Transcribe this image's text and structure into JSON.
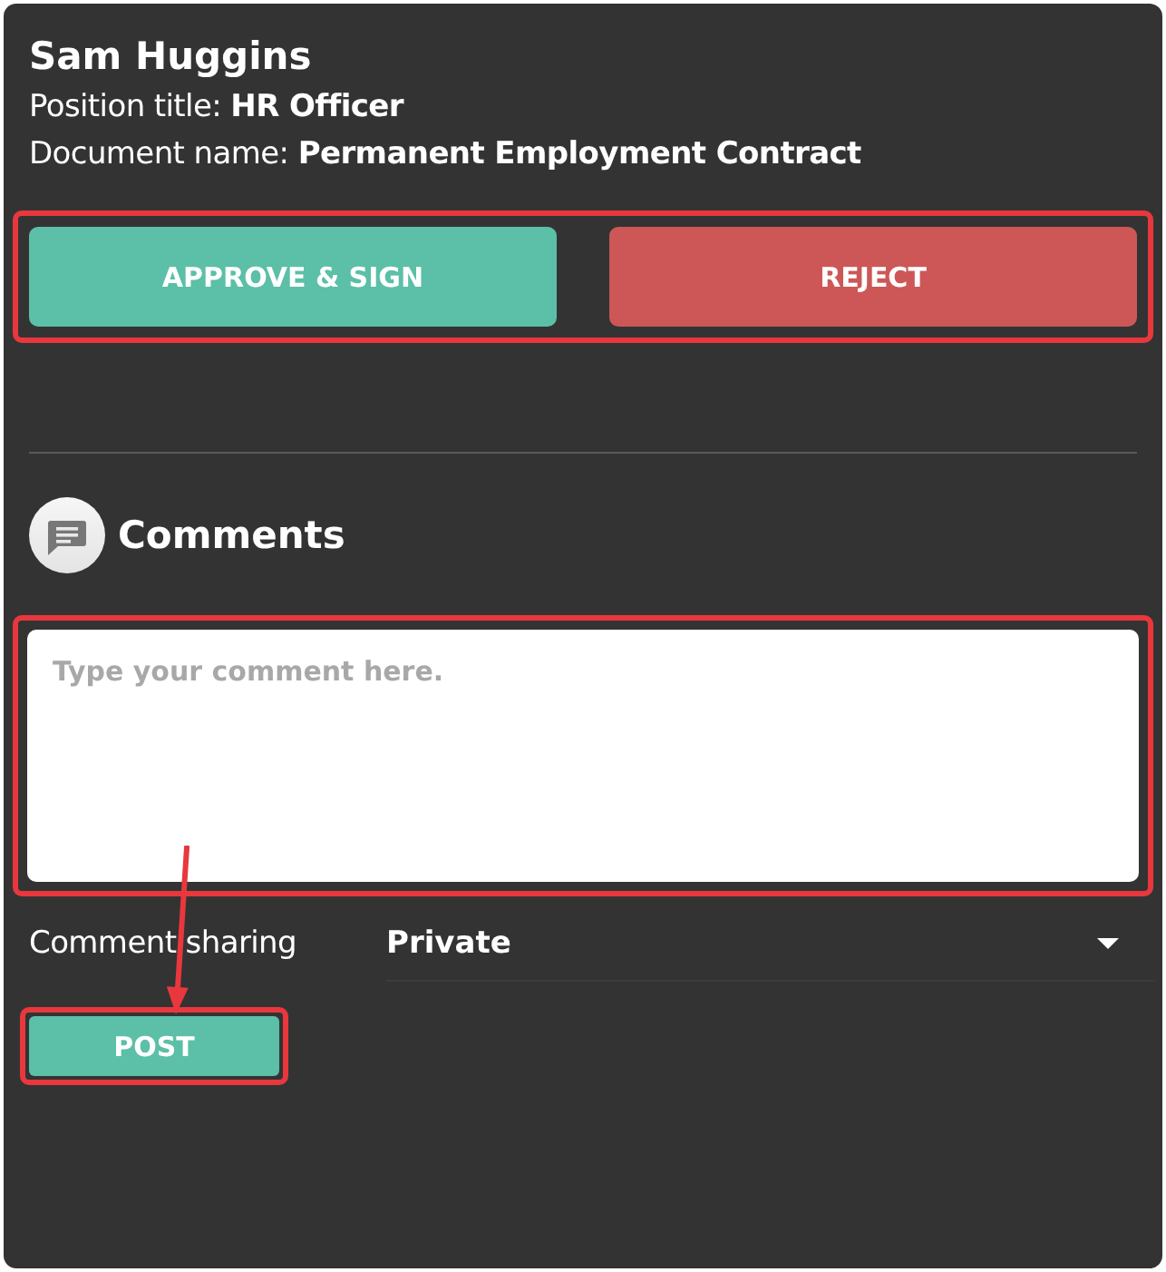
{
  "person": {
    "name": "Sam Huggins"
  },
  "details": [
    "Position title: **HR Officer**",
    "Document name: **Permanent Employment Contract**"
  ],
  "actions": {
    "highlighted": true,
    "buttons": [
      {
        "label": "APPROVE & SIGN",
        "kind": "approve"
      },
      {
        "label": "REJECT",
        "kind": "reject"
      }
    ]
  },
  "comments": {
    "title": "Comments",
    "input": {
      "placeholder": "Type your comment here.",
      "highlighted": true
    },
    "sharing": {
      "label": "Comment sharing",
      "value": "Private"
    },
    "post_button": {
      "label": "POST",
      "highlighted": true,
      "pointed_at": true
    }
  }
}
